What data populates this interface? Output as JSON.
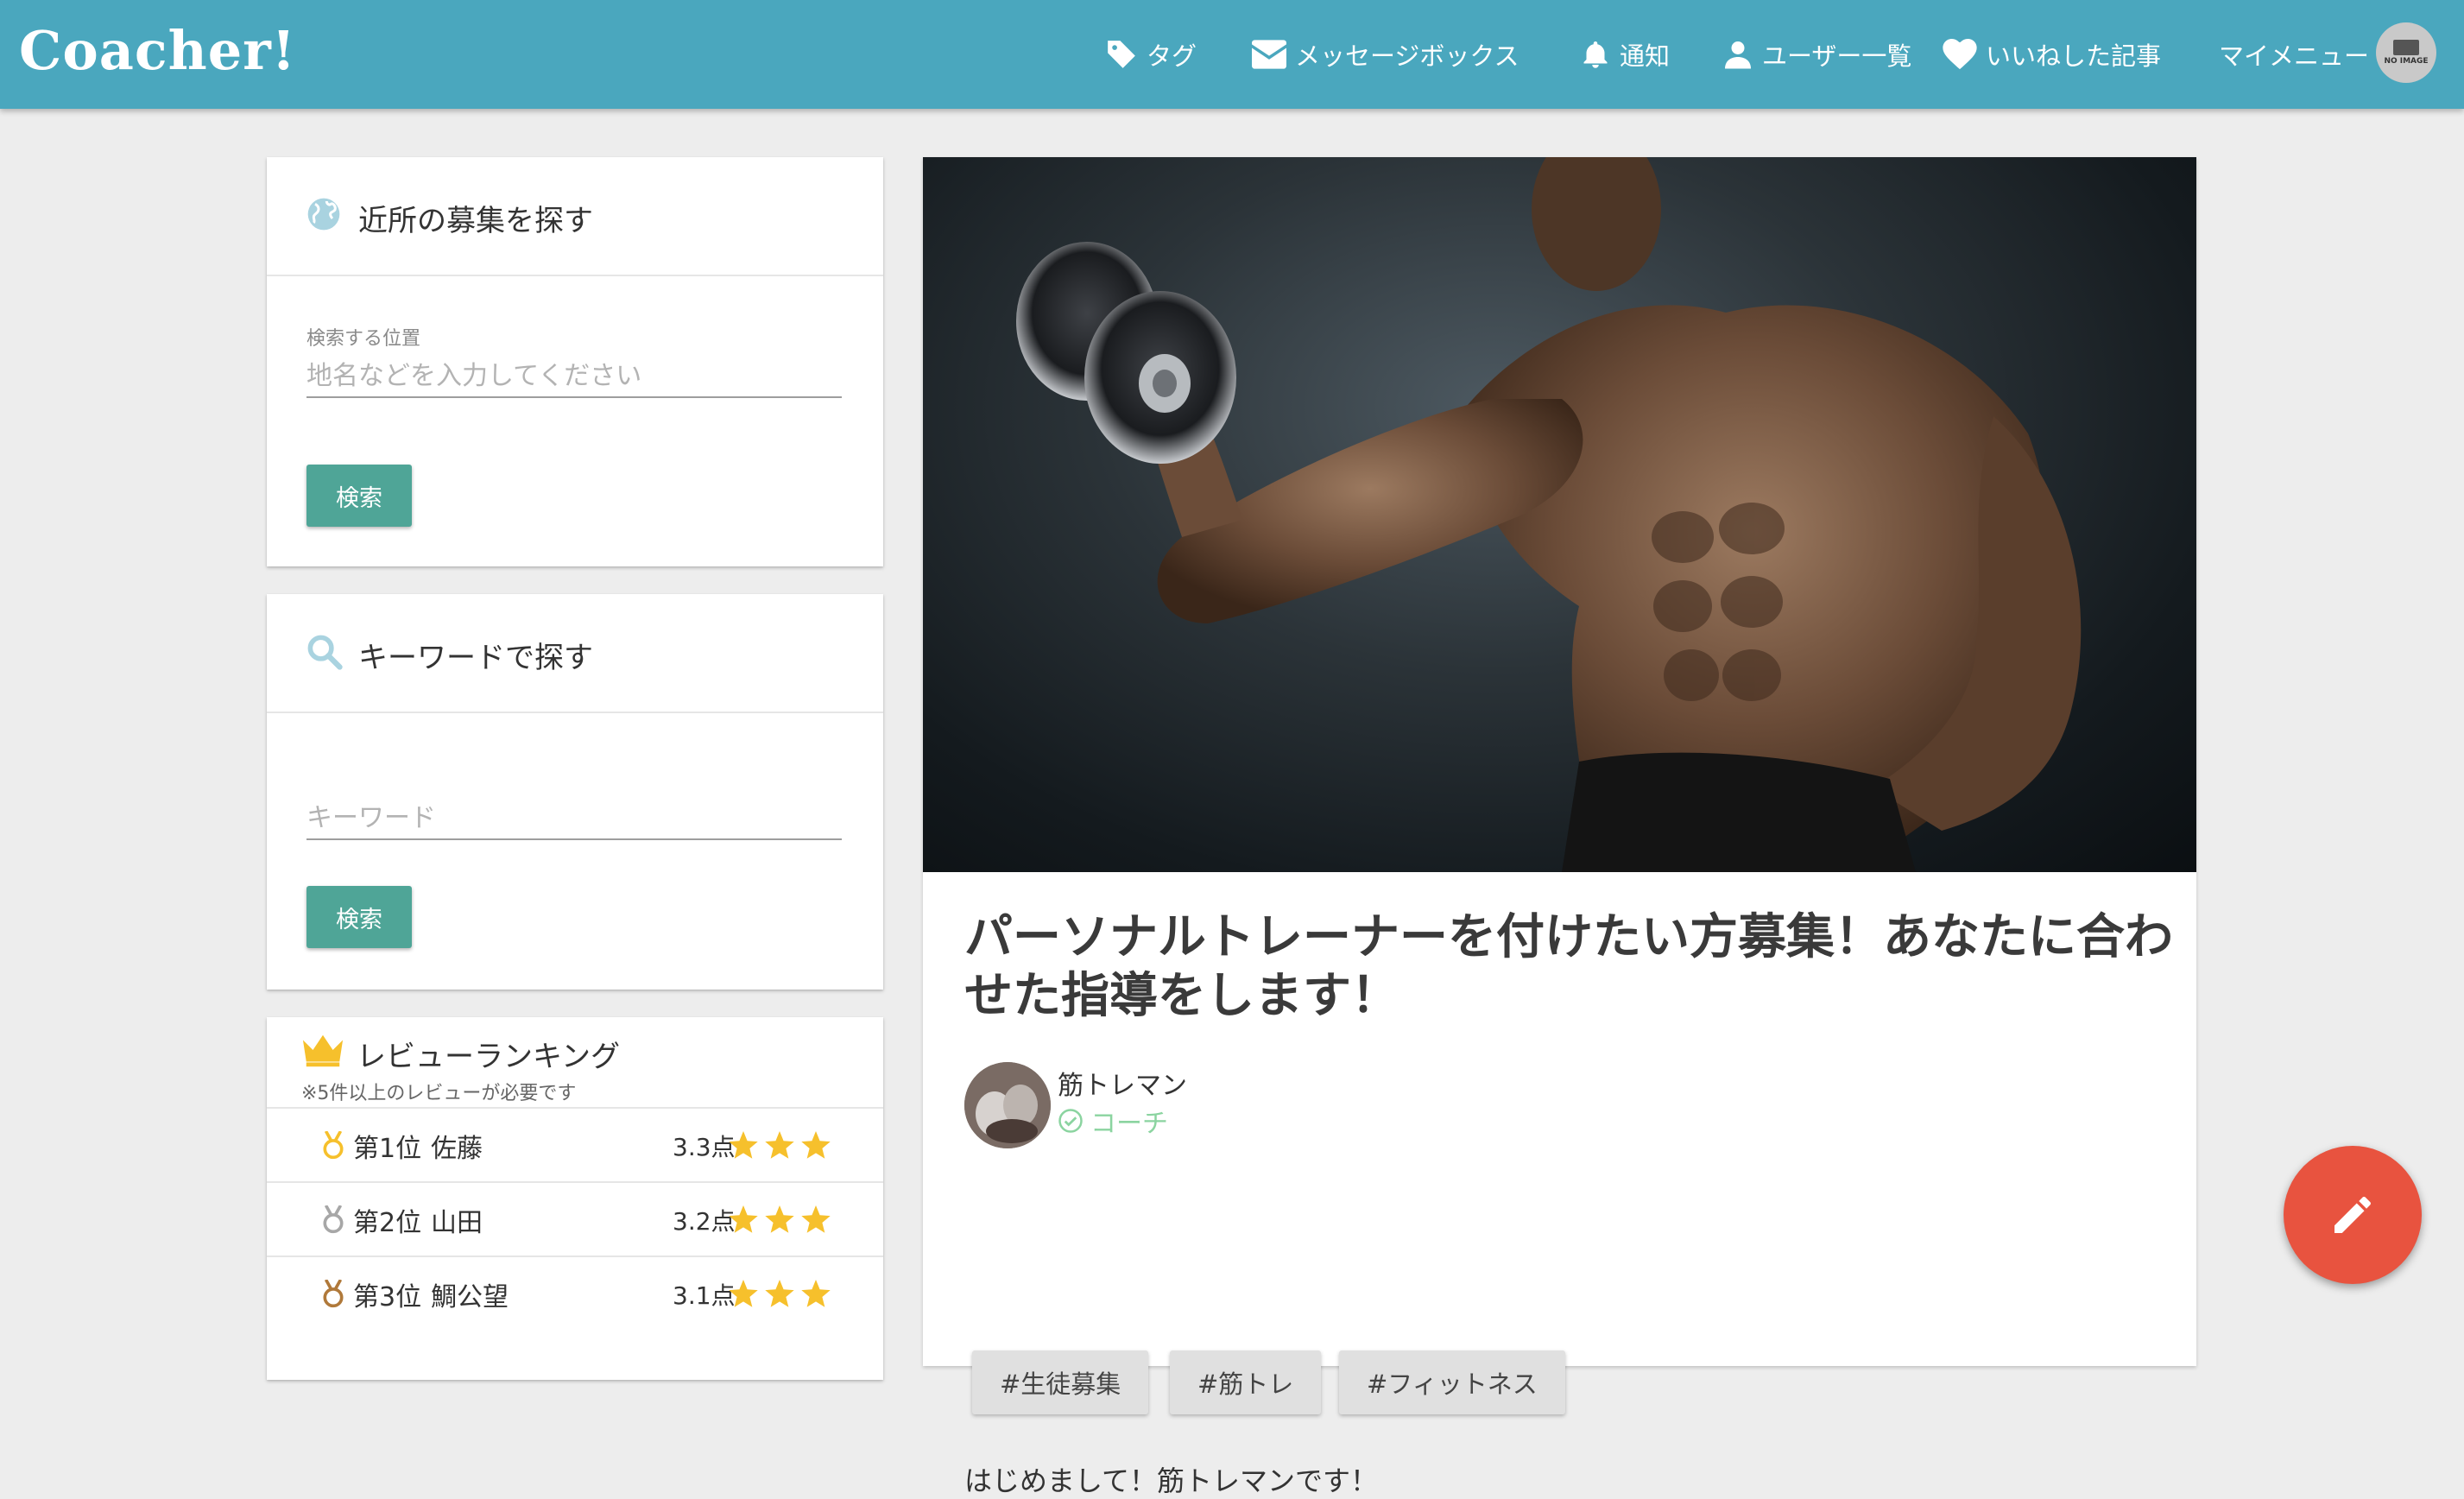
{
  "brand": "Coacher!",
  "nav": {
    "tags": "タグ",
    "messages": "メッセージボックス",
    "notifications": "通知",
    "users": "ユーザー一覧",
    "liked": "いいねした記事",
    "mymenu": "マイメニュー",
    "avatar_text": "NO IMAGE"
  },
  "nearby": {
    "title": "近所の募集を探す",
    "label": "検索する位置",
    "placeholder": "地名などを入力してください",
    "button": "検索"
  },
  "keyword": {
    "title": "キーワードで探す",
    "placeholder": "キーワード",
    "button": "検索"
  },
  "ranking": {
    "title": "レビューランキング",
    "note": "※5件以上のレビューが必要です",
    "rows": [
      {
        "pos": "第1位",
        "name": "佐藤",
        "score": "3.3点",
        "stars": 3
      },
      {
        "pos": "第2位",
        "name": "山田",
        "score": "3.2点",
        "stars": 3
      },
      {
        "pos": "第3位",
        "name": "鯛公望",
        "score": "3.1点",
        "stars": 3
      }
    ]
  },
  "post": {
    "title": "パーソナルトレーナーを付けたい方募集！あなたに合わせた指導をします！",
    "author": "筋トレマン",
    "role": "コーチ",
    "tags": [
      "#生徒募集",
      "#筋トレ",
      "#フィットネス"
    ],
    "body": "はじめまして！筋トレマンです！"
  },
  "colors": {
    "navbar": "#4aa7be",
    "button": "#4fa597",
    "fab": "#e8533f",
    "role": "#8bd4a0",
    "star": "#f6c02c"
  }
}
